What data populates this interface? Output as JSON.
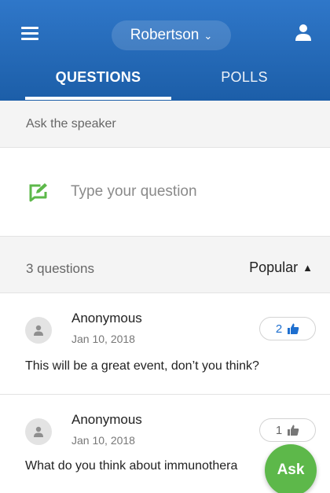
{
  "header": {
    "event_name": "Robertson",
    "menu_icon": "hamburger-menu-icon",
    "profile_icon": "user-profile-icon",
    "tabs": [
      {
        "label": "QUESTIONS",
        "active": true
      },
      {
        "label": "POLLS",
        "active": false
      }
    ]
  },
  "ask": {
    "section_label": "Ask the speaker",
    "placeholder": "Type your question",
    "icon": "compose-icon"
  },
  "list": {
    "count_label": "3 questions",
    "sort_label": "Popular",
    "sort_icon": "sort-icon"
  },
  "questions": [
    {
      "author": "Anonymous",
      "date": "Jan 10, 2018",
      "text": "This will be a great event, don’t you think?",
      "likes": "2",
      "liked": true
    },
    {
      "author": "Anonymous",
      "date": "Jan 10, 2018",
      "text": "What do you think about immunothera",
      "likes": "1",
      "liked": false
    }
  ],
  "fab": {
    "label": "Ask"
  },
  "colors": {
    "header": "#2370c3",
    "accent_green": "#5db84a",
    "like_active": "#1e6fcf"
  }
}
